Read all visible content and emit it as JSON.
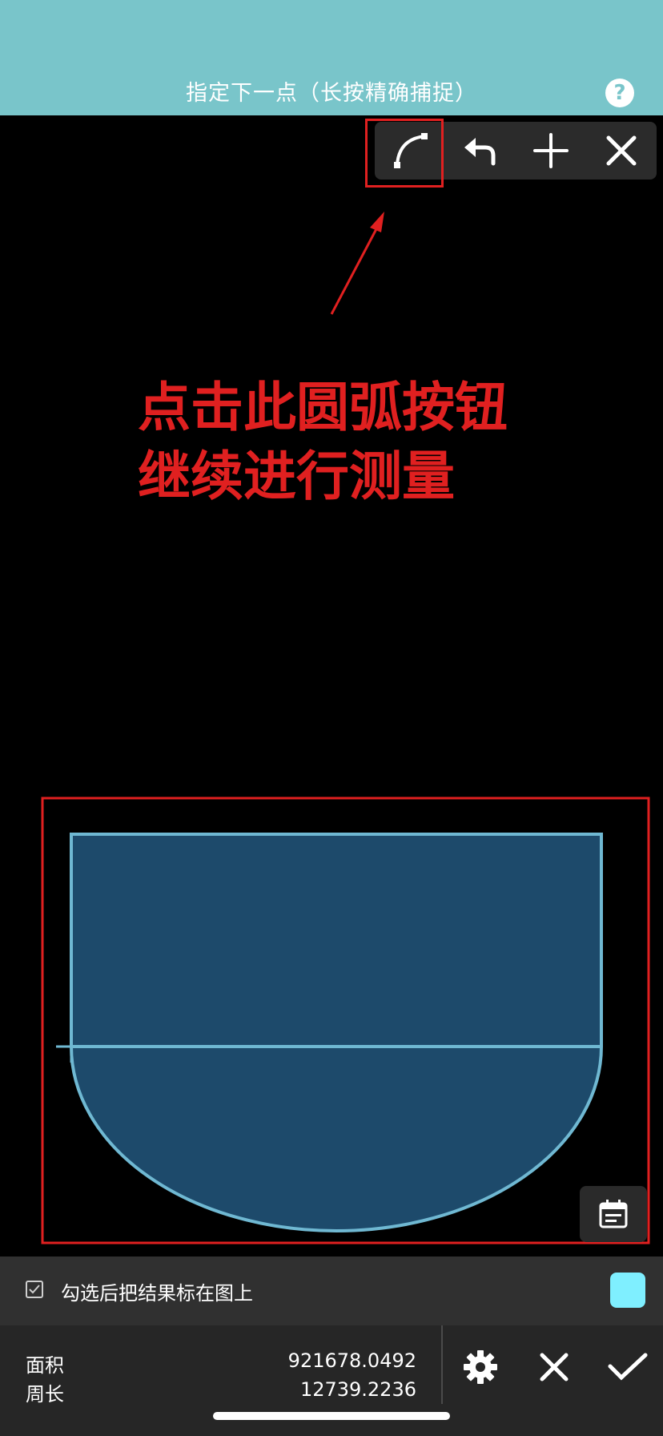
{
  "header": {
    "title": "指定下一点（长按精确捕捉）",
    "help_label": "?"
  },
  "toolbar": {
    "buttons": [
      "arc-icon",
      "undo-icon",
      "plus-icon",
      "close-icon"
    ]
  },
  "annotation": {
    "line1": "点击此圆弧按钮",
    "line2": "继续进行测量",
    "color": "#e02020"
  },
  "shape": {
    "fill": "#1d4a6b",
    "stroke": "#6fb8d2"
  },
  "options": {
    "checkbox_label": "勾选后把结果标在图上",
    "checked": true,
    "swatch_color": "#7fefff"
  },
  "results": {
    "area_label": "面积",
    "area_value": "921678.0492",
    "perimeter_label": "周长",
    "perimeter_value": "12739.2236"
  }
}
